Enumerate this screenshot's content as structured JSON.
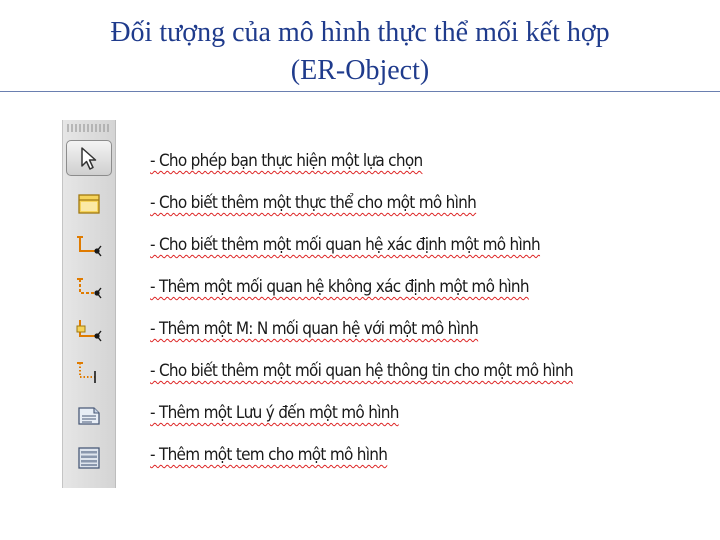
{
  "slide": {
    "title_line1": "Đối tượng của mô hình thực thể mối kết hợp",
    "title_line2": "(ER-Object)"
  },
  "toolbar": {
    "tools": [
      {
        "icon": "pointer-arrow-icon",
        "selected": true
      },
      {
        "icon": "entity-icon",
        "selected": false
      },
      {
        "icon": "identifying-relationship-icon",
        "selected": false
      },
      {
        "icon": "non-identifying-relationship-icon",
        "selected": false
      },
      {
        "icon": "many-to-many-relationship-icon",
        "selected": false
      },
      {
        "icon": "informative-relationship-icon",
        "selected": false
      },
      {
        "icon": "note-icon",
        "selected": false
      },
      {
        "icon": "stamp-icon",
        "selected": false
      }
    ]
  },
  "descriptions": [
    "- Cho phép bạn thực hiện một lựa chọn",
    "- Cho biết thêm một thực thể cho một mô hình",
    "- Cho biết thêm một mối quan hệ xác định một mô hình",
    "- Thêm một mối quan hệ không xác định một mô hình",
    "- Thêm một M: N mối quan hệ với một mô hình",
    "- Cho biết thêm một mối quan hệ thông tin cho một mô hình",
    "- Thêm một Lưu ý đến một mô hình",
    "- Thêm một tem cho một mô hình"
  ],
  "colors": {
    "title": "#1f3b8c",
    "text": "#1a1a1a",
    "spellcheck_underline": "#d22",
    "entity_yellow": "#f5d35a",
    "relationship_orange": "#e07b00"
  }
}
